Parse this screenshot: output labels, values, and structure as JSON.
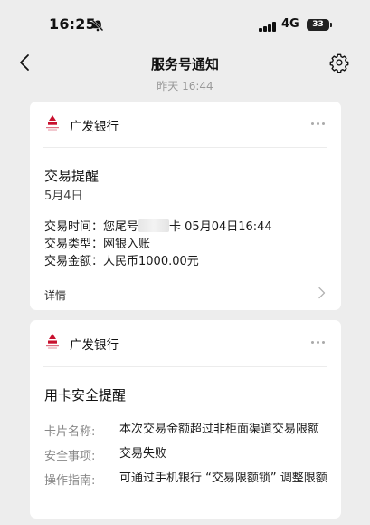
{
  "status_bar": {
    "time": "16:25",
    "network": "4G",
    "battery": "33"
  },
  "nav": {
    "title": "服务号通知"
  },
  "timestamp": "昨天 16:44",
  "cards": [
    {
      "sender": "广发银行",
      "title": "交易提醒",
      "date": "5月4日",
      "fields": [
        {
          "label": "交易时间：",
          "prefix": "您尾号",
          "suffix": "卡 05月04日16:44"
        },
        {
          "label": "交易类型：",
          "value": "网银入账"
        },
        {
          "label": "交易金额：",
          "value": "人民币1000.00元"
        }
      ],
      "details_label": "详情"
    },
    {
      "sender": "广发银行",
      "title": "用卡安全提醒",
      "rows": [
        {
          "label": "卡片名称:",
          "value": "本次交易金额超过非柜面渠道交易限额"
        },
        {
          "label": "安全事项:",
          "value": "交易失败"
        },
        {
          "label": "操作指南:",
          "value": "可通过手机银行 “交易限额锁” 调整限额"
        }
      ]
    }
  ],
  "icons": {
    "back": "chevron-left-icon",
    "settings": "gear-icon",
    "more": "more-dots-icon",
    "silent": "bell-slash-icon",
    "bank_logo": "cgb-logo-icon",
    "details": "chevron-right-icon"
  },
  "colors": {
    "background": "#ededed",
    "card": "#ffffff",
    "brand_red": "#c8102e",
    "muted_text": "#888888"
  }
}
